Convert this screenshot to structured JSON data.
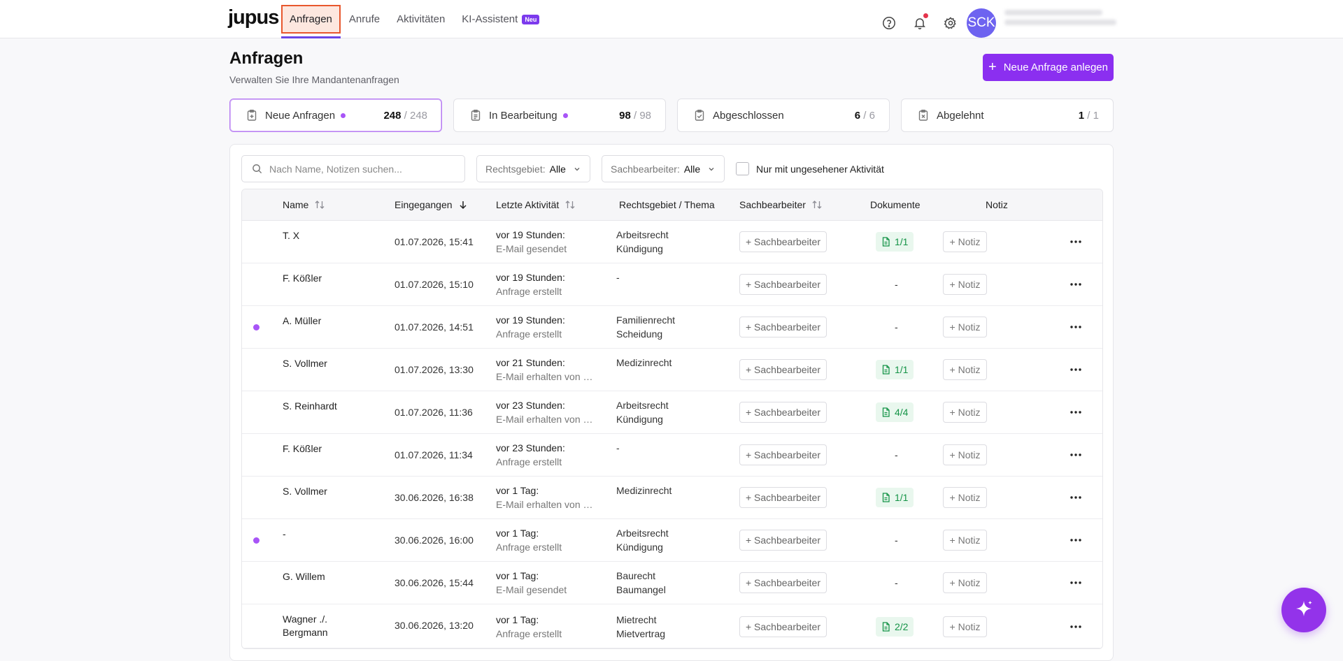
{
  "app": {
    "logo": "jupus"
  },
  "nav": {
    "items": [
      {
        "label": "Anfragen"
      },
      {
        "label": "Anrufe"
      },
      {
        "label": "Aktivitäten"
      },
      {
        "label": "KI-Assistent",
        "badge": "Neu"
      }
    ]
  },
  "user": {
    "initials": "SCK"
  },
  "header": {
    "title": "Anfragen",
    "subtitle": "Verwalten Sie Ihre Mandantenanfragen",
    "new_button": "Neue Anfrage anlegen"
  },
  "status_cards": [
    {
      "label": "Neue Anfragen",
      "count": "248",
      "total": " / 248",
      "unseen": true
    },
    {
      "label": "In Bearbeitung",
      "count": "98",
      "total": " / 98",
      "unseen": true
    },
    {
      "label": "Abgeschlossen",
      "count": "6",
      "total": " / 6",
      "unseen": false
    },
    {
      "label": "Abgelehnt",
      "count": "1",
      "total": " / 1",
      "unseen": false
    }
  ],
  "filters": {
    "search_placeholder": "Nach Name, Notizen suchen...",
    "rechtsgebiet_label": "Rechtsgebiet:",
    "rechtsgebiet_value": "Alle",
    "sachbearbeiter_label": "Sachbearbeiter:",
    "sachbearbeiter_value": "Alle",
    "unseen_checkbox": "Nur mit ungesehener Aktivität"
  },
  "table": {
    "columns": [
      "Name",
      "Eingegangen",
      "Letzte Aktivität",
      "Rechtsgebiet / Thema",
      "Sachbearbeiter",
      "Dokumente",
      "Notiz"
    ],
    "assign_label": "+ Sachbearbeiter",
    "note_label": "+ Notiz",
    "rows": [
      {
        "name": "T. X",
        "date": "01.07.2026, 15:41",
        "act_time": "vor 19 Stunden:",
        "act_desc": "E-Mail gesendet",
        "rg1": "Arbeitsrecht",
        "rg2": "Kündigung",
        "docs": "1/1",
        "unseen": false
      },
      {
        "name": "F. Kößler",
        "date": "01.07.2026, 15:10",
        "act_time": "vor 19 Stunden:",
        "act_desc": "Anfrage erstellt",
        "rg1": "-",
        "rg2": "",
        "docs": "-",
        "unseen": false
      },
      {
        "name": "A. Müller",
        "date": "01.07.2026, 14:51",
        "act_time": "vor 19 Stunden:",
        "act_desc": "Anfrage erstellt",
        "rg1": "Familienrecht",
        "rg2": "Scheidung",
        "docs": "-",
        "unseen": true
      },
      {
        "name": "S. Vollmer",
        "date": "01.07.2026, 13:30",
        "act_time": "vor 21 Stunden:",
        "act_desc": "E-Mail erhalten von …",
        "rg1": "Medizinrecht",
        "rg2": "",
        "docs": "1/1",
        "unseen": false
      },
      {
        "name": "S. Reinhardt",
        "date": "01.07.2026, 11:36",
        "act_time": "vor 23 Stunden:",
        "act_desc": "E-Mail erhalten von …",
        "rg1": "Arbeitsrecht",
        "rg2": "Kündigung",
        "docs": "4/4",
        "unseen": false
      },
      {
        "name": "F. Kößler",
        "date": "01.07.2026, 11:34",
        "act_time": "vor 23 Stunden:",
        "act_desc": "Anfrage erstellt",
        "rg1": "-",
        "rg2": "",
        "docs": "-",
        "unseen": false
      },
      {
        "name": "S. Vollmer",
        "date": "30.06.2026, 16:38",
        "act_time": "vor 1 Tag:",
        "act_desc": "E-Mail erhalten von …",
        "rg1": "Medizinrecht",
        "rg2": "",
        "docs": "1/1",
        "unseen": false
      },
      {
        "name": "-",
        "date": "30.06.2026, 16:00",
        "act_time": "vor 1 Tag:",
        "act_desc": "Anfrage erstellt",
        "rg1": "Arbeitsrecht",
        "rg2": "Kündigung",
        "docs": "-",
        "unseen": true
      },
      {
        "name": "G. Willem",
        "date": "30.06.2026, 15:44",
        "act_time": "vor 1 Tag:",
        "act_desc": "E-Mail gesendet",
        "rg1": "Baurecht",
        "rg2": "Baumangel",
        "docs": "-",
        "unseen": false
      },
      {
        "name": "Wagner ./. Bergmann",
        "date": "30.06.2026, 13:20",
        "act_time": "vor 1 Tag:",
        "act_desc": "Anfrage erstellt",
        "rg1": "Mietrecht",
        "rg2": "Mietvertrag",
        "docs": "2/2",
        "unseen": false
      }
    ]
  },
  "colors": {
    "accent": "#8b2ff0",
    "unseen_dot": "#a855f7",
    "doc_green": "#159447",
    "nav_highlight": "#e8572d"
  },
  "icons": [
    "help-icon",
    "bell-icon",
    "gear-icon",
    "search-icon",
    "chevron-down-icon",
    "sort-icon",
    "sort-desc-icon",
    "clipboard-icon",
    "document-icon",
    "more-icon",
    "sparkle-icon"
  ]
}
